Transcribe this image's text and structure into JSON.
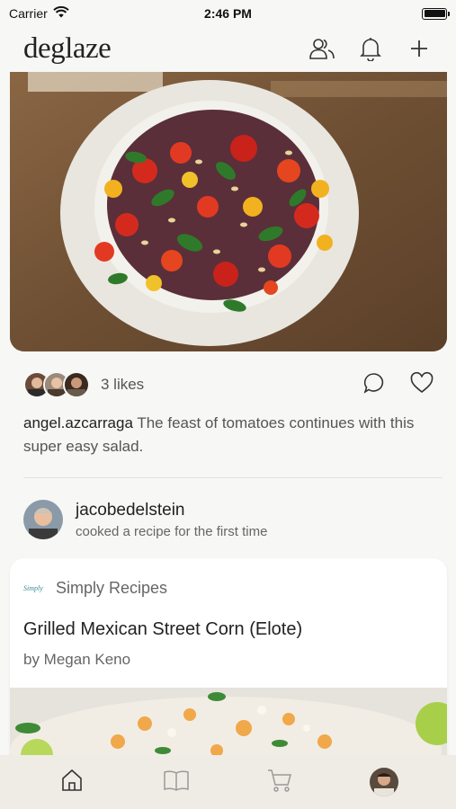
{
  "status_bar": {
    "carrier": "Carrier",
    "time": "2:46 PM"
  },
  "header": {
    "logo": "deglaze"
  },
  "post": {
    "likes_text": "3 likes",
    "caption_user": "angel.azcarraga",
    "caption_text": " The feast of tomatoes continues with this super easy salad."
  },
  "activity": {
    "username": "jacobedelstein",
    "description": "cooked a recipe for the first time"
  },
  "recipe": {
    "source_logo": "Simply",
    "source_name": "Simply Recipes",
    "title": "Grilled Mexican Street Corn (Elote)",
    "author": "by Megan Keno"
  },
  "colors": {
    "background": "#f7f7f6",
    "tab_bar": "#efece6",
    "card": "#ffffff",
    "text": "#222222"
  }
}
